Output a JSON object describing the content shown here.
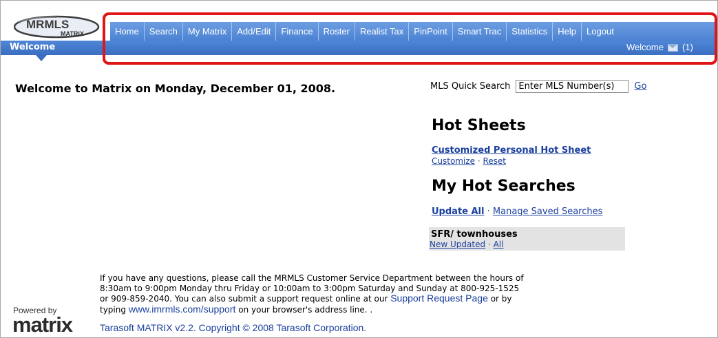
{
  "header": {
    "logo_text": "MRMLS",
    "logo_subtext": "MATRIX",
    "nav_items": [
      {
        "label": "Home"
      },
      {
        "label": "Search"
      },
      {
        "label": "My Matrix"
      },
      {
        "label": "Add/Edit"
      },
      {
        "label": "Finance"
      },
      {
        "label": "Roster"
      },
      {
        "label": "Realist Tax"
      },
      {
        "label": "PinPoint"
      },
      {
        "label": "Smart Trac"
      },
      {
        "label": "Statistics"
      },
      {
        "label": "Help"
      },
      {
        "label": "Logout"
      }
    ],
    "active_tab": "Welcome",
    "welcome_right_label": "Welcome",
    "message_count": "(1)",
    "colors": {
      "nav_blue": "#4b82d2",
      "bar_blue": "#3a6ec2",
      "highlight_red": "#e01515"
    }
  },
  "main": {
    "welcome_heading": "Welcome to Matrix on Monday, December 01, 2008."
  },
  "quick_search": {
    "label": "MLS Quick Search",
    "placeholder": "Enter MLS Number(s)",
    "go_label": "Go"
  },
  "hot_sheets": {
    "title": "Hot Sheets",
    "link": "Customized Personal Hot Sheet",
    "customize": "Customize",
    "separator": "·",
    "reset": "Reset"
  },
  "hot_searches": {
    "title": "My Hot Searches",
    "update_all": "Update All",
    "separator": "·",
    "manage": "Manage Saved Searches",
    "saved_search": {
      "name": "SFR/ townhouses",
      "new_updated": "New Updated",
      "separator": "·",
      "all": "All"
    }
  },
  "footer": {
    "help_text_1": "If you have any questions, please call the MRMLS Customer Service Department between the hours of 8:30am to 9:00pm Monday thru Friday or 10:00am to 3:00pm Saturday and Sunday at 800-925-1525 or 909-859-2040. You can also submit a support request online at our",
    "support_link": "Support Request Page",
    "help_text_2": "or by typing",
    "support_url": "www.imrmls.com/support",
    "help_text_3": "on your browser's address line. .",
    "powered_by": "Powered by",
    "powered_logo": "matrix",
    "copyright": "Tarasoft MATRIX v2.2. Copyright © 2008 Tarasoft Corporation."
  }
}
